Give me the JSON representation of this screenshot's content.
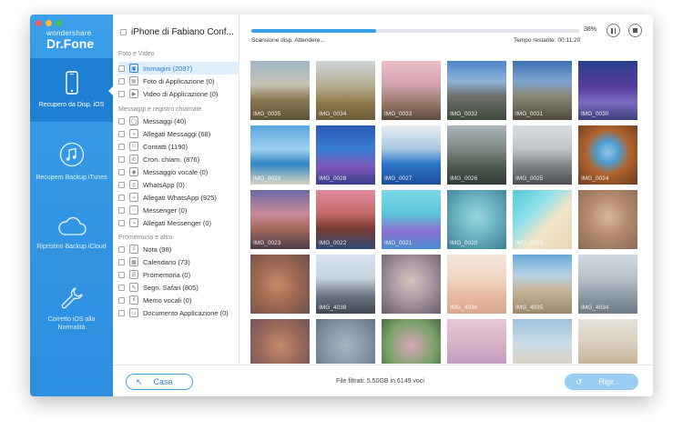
{
  "sidebar": {
    "brand_top": "wondershare",
    "brand_main": "Dr.Fone",
    "items": [
      {
        "label": "Recupero da Disp. iOS",
        "icon": "phone-icon",
        "active": true
      },
      {
        "label": "Recupero Backup iTunes",
        "icon": "music-note-icon",
        "active": false
      },
      {
        "label": "Ripristino Backup iCloud",
        "icon": "cloud-icon",
        "active": false
      },
      {
        "label": "Corretto iOS alla Normalità",
        "icon": "wrench-icon",
        "active": false
      }
    ]
  },
  "tree": {
    "device": "iPhone di Fabiano Conf...",
    "groups": [
      {
        "title": "Foto e Video",
        "items": [
          {
            "label": "Immagini (2087)",
            "icon": "image-icon",
            "selected": true
          },
          {
            "label": "Foto di Applicazione (0)",
            "icon": "app-photo-icon"
          },
          {
            "label": "Video di Applicazione (0)",
            "icon": "video-icon"
          }
        ]
      },
      {
        "title": "Messaggi e registro chiamate",
        "items": [
          {
            "label": "Messaggi (40)",
            "icon": "message-icon"
          },
          {
            "label": "Allegati Messaggi (68)",
            "icon": "attachment-icon"
          },
          {
            "label": "Contatti (1190)",
            "icon": "contact-icon"
          },
          {
            "label": "Cron. chiam. (876)",
            "icon": "call-icon"
          },
          {
            "label": "Messaggio vocale (0)",
            "icon": "voicemail-icon"
          },
          {
            "label": "WhatsApp (0)",
            "icon": "whatsapp-icon"
          },
          {
            "label": "Allegati WhatsApp (925)",
            "icon": "attachment-icon"
          },
          {
            "label": "Messenger (0)",
            "icon": "messenger-icon"
          },
          {
            "label": "Allegati Messenger (0)",
            "icon": "attachment-icon"
          }
        ]
      },
      {
        "title": "Promemoria e altro",
        "items": [
          {
            "label": "Nota (98)",
            "icon": "note-icon"
          },
          {
            "label": "Calendario (73)",
            "icon": "calendar-icon"
          },
          {
            "label": "Promemoria (0)",
            "icon": "reminder-icon"
          },
          {
            "label": "Segn. Safari (805)",
            "icon": "safari-icon"
          },
          {
            "label": "Memo vocali (0)",
            "icon": "voice-memo-icon"
          },
          {
            "label": "Documento Applicazione (0)",
            "icon": "document-icon"
          }
        ]
      }
    ]
  },
  "progress": {
    "percent": 38,
    "percent_label": "38%",
    "status": "Scansione disp. Attendere...",
    "remaining": "Tempo restante:  00:11:20"
  },
  "colors": {
    "accent": "#3a9ee8",
    "sidebar": "#2c8fe0"
  },
  "thumbnails": [
    {
      "caption": "IMG_0035",
      "bg": "linear-gradient(#9fb6c9 0%, #c7c4b4 40%, #8a7a55 65%, #5d5236 100%)"
    },
    {
      "caption": "IMG_0034",
      "bg": "linear-gradient(#cfd6d9 0%, #b3aa8a 45%, #8f7b4e 70%, #6b5a38 100%)"
    },
    {
      "caption": "IMG_0033",
      "bg": "linear-gradient(#e9bfc6 0%, #d4a2b0 40%, #9a7b6d 70%, #5a4a3a 100%)"
    },
    {
      "caption": "IMG_0032",
      "bg": "linear-gradient(#4f86c9 0%, #8fb1d8 35%, #6e6f6a 60%, #3d4a3b 100%)"
    },
    {
      "caption": "IMG_0031",
      "bg": "linear-gradient(#3d6fb2 0%, #7fa4cf 35%, #8a8774 60%, #4e4a3e 100%)"
    },
    {
      "caption": "IMG_0030",
      "bg": "linear-gradient(#2a3f8f 0%, #5a3e9a 45%, #7c6bc2 70%, #3b3f7d 100%)"
    },
    {
      "caption": "IMG_0029",
      "bg": "linear-gradient(#5aa6e0 0%, #9fd1ef 40%, #2f86c4 65%, #d9d4c4 100%)"
    },
    {
      "caption": "IMG_0028",
      "bg": "linear-gradient(#2b58b5 0%, #3a7fd2 40%, #7c57b8 70%, #3a3f8a 100%)"
    },
    {
      "caption": "IMG_0027",
      "bg": "linear-gradient(#e9eef2 0%, #a9c7e2 40%, #2a76c8 65%, #1d4e9a 100%)"
    },
    {
      "caption": "IMG_0026",
      "bg": "linear-gradient(#a9b6bd 0%, #7f8a84 40%, #4c5a4e 70%, #2f3a35 100%)"
    },
    {
      "caption": "IMG_0025",
      "bg": "linear-gradient(#d9dde0 0%, #bfc5c9 40%, #7a7f82 70%, #4a4e52 100%)"
    },
    {
      "caption": "IMG_0024",
      "bg": "radial-gradient(circle at 50% 45%, #8fc5e6 0%, #4e9ccf 25%, #b0642e 50%, #6b3a1e 100%)"
    },
    {
      "caption": "IMG_0023",
      "bg": "linear-gradient(#6a6aa6 0%, #c98a9a 40%, #a56a5c 65%, #4a3a48 100%)"
    },
    {
      "caption": "IMG_0022",
      "bg": "linear-gradient(#e08a9c 0%, #c46a6a 40%, #7a3a32 65%, #2e4d78 100%)"
    },
    {
      "caption": "IMG_0021",
      "bg": "linear-gradient(#7fd8e6 0%, #5bc6da 40%, #8b6fd0 70%, #4a8fd0 100%)"
    },
    {
      "caption": "IMG_0020",
      "bg": "radial-gradient(circle at 50% 45%, #9ad6df 0%, #6fb8c6 40%, #3e7d93 100%)"
    },
    {
      "caption": "IMG_0019",
      "bg": "linear-gradient(135deg, #57c8d9 0%, #8fe0ea 35%, #f1e4c8 60%, #e8d6b6 100%)"
    },
    {
      "caption": "",
      "bg": "radial-gradient(circle at 50% 45%, #d8b79a 0%, #b58a6c 45%, #8a6a55 100%)"
    },
    {
      "caption": "",
      "bg": "radial-gradient(circle at 45% 50%, #c98a6a 0%, #a06a54 45%, #6e4f48 100%)"
    },
    {
      "caption": "IMG_4038",
      "bg": "linear-gradient(#d9e4ee 0%, #c7d3de 40%, #6b7580 70%, #3e4752 100%)"
    },
    {
      "caption": "",
      "bg": "radial-gradient(circle at 50% 45%, #d6c3bc 0%, #a898a3 45%, #6a5c6a 100%)"
    },
    {
      "caption": "IMG_4036",
      "bg": "linear-gradient(#f2e6dc 0%, #f0d6c3 40%, #e7b89f 70%, #d9a88e 100%)"
    },
    {
      "caption": "IMG_4035",
      "bg": "linear-gradient(#6aa8d8 0%, #b7d2e6 35%, #c7b59a 60%, #9a8a6e 100%)"
    },
    {
      "caption": "IMG_4034",
      "bg": "linear-gradient(#cfd9e2 0%, #b8c2ca 40%, #8e9aa4 70%, #6e7a84 100%)"
    },
    {
      "caption": "",
      "bg": "radial-gradient(circle at 50% 45%, #c58a6a 0%, #9a6a5a 45%, #6a5058 100%)"
    },
    {
      "caption": "",
      "bg": "radial-gradient(circle at 50% 45%, #a9b4c2 0%, #8a97a8 45%, #5e6b7c 100%)"
    },
    {
      "caption": "",
      "bg": "radial-gradient(circle at 50% 45%, #d9a6b8 0%, #7aa26a 55%, #3e5a38 100%)"
    },
    {
      "caption": "",
      "bg": "linear-gradient(#e6c9d6 0%, #d8b2c6 40%, #c79fc0 70%, #b58fb4 100%)"
    },
    {
      "caption": "",
      "bg": "linear-gradient(#9fc2dc 0%, #c9dbe7 40%, #d9d3c9 70%, #b9b2a6 100%)"
    },
    {
      "caption": "",
      "bg": "linear-gradient(#e6e2d9 0%, #d9cfc0 40%, #c9b89c 70%, #b3a080 100%)"
    }
  ],
  "footer": {
    "home_label": "Casa",
    "filtered": "File filtrati: 5.50GB in 6149 voci",
    "recover_label": "Ripr."
  }
}
